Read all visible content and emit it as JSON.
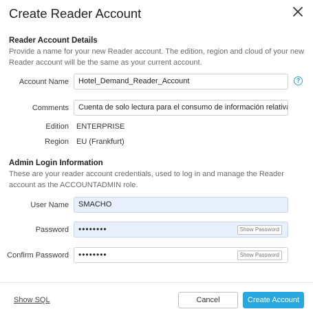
{
  "dialog": {
    "title": "Create Reader Account",
    "close_icon": "close-icon"
  },
  "details": {
    "heading": "Reader Account Details",
    "description": "Provide a name for your new Reader account. The edition, region and cloud of your new Reader account will be the same as your current account.",
    "account_name_label": "Account Name",
    "account_name_value": "Hotel_Demand_Reader_Account",
    "help_icon": "help-icon",
    "help_glyph": "?",
    "comments_label": "Comments",
    "comments_value": "Cuenta de solo lectura para el consumo de información relativa a",
    "edition_label": "Edition",
    "edition_value": "ENTERPRISE",
    "region_label": "Region",
    "region_value": "EU (Frankfurt)"
  },
  "admin": {
    "heading": "Admin Login Information",
    "description": "These are your reader account credentials, used to log in and manage the Reader account as the ACCOUNTADMIN role.",
    "username_label": "User Name",
    "username_value": "SMACHO",
    "password_label": "Password",
    "password_value": "••••••••",
    "confirm_label": "Confirm Password",
    "confirm_value": "••••••••",
    "show_password_label": "Show Password"
  },
  "footer": {
    "show_sql": "Show SQL",
    "cancel": "Cancel",
    "create": "Create Account"
  },
  "colors": {
    "accent": "#29a8e0",
    "autofill": "#e8f0fe"
  }
}
